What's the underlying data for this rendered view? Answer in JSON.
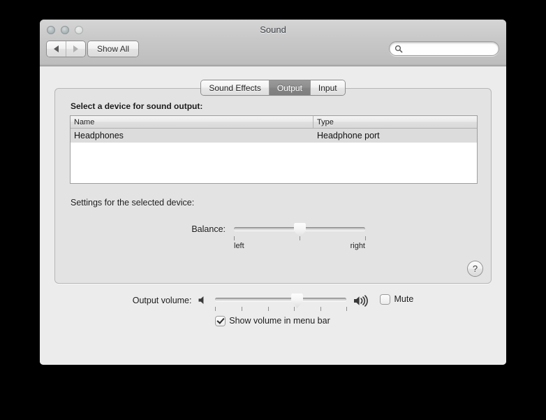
{
  "window": {
    "title": "Sound",
    "traffic_lights": [
      "close-button",
      "minimize-button",
      "zoom-button"
    ]
  },
  "toolbar": {
    "back_label": "◀",
    "forward_label": "▶",
    "show_all_label": "Show All",
    "search_value": "",
    "search_placeholder": ""
  },
  "tabs": [
    {
      "label": "Sound Effects",
      "active": false
    },
    {
      "label": "Output",
      "active": true
    },
    {
      "label": "Input",
      "active": false
    }
  ],
  "panel": {
    "device_list_label": "Select a device for sound output:",
    "table": {
      "columns": [
        "Name",
        "Type"
      ],
      "rows": [
        {
          "name": "Headphones",
          "type": "Headphone port",
          "selected": true
        }
      ]
    },
    "settings_label": "Settings for the selected device:",
    "balance": {
      "label": "Balance:",
      "value": 50,
      "min_label": "left",
      "max_label": "right",
      "tick_count": 3
    },
    "help_label": "?"
  },
  "bottom": {
    "output_volume_label": "Output volume:",
    "volume_value": 62,
    "volume_tick_count": 6,
    "speaker_low_icon": "speaker-quiet-icon",
    "speaker_high_icon": "speaker-loud-icon",
    "mute_label": "Mute",
    "mute_checked": false,
    "show_volume_label": "Show volume in menu bar",
    "show_volume_checked": true
  },
  "colors": {
    "window_bg": "#ececec",
    "panel_bg": "#e3e3e3",
    "titlebar_top": "#d5d5d5",
    "titlebar_bottom": "#bdbdbd",
    "active_tab_bg": "#848484",
    "selected_row_bg": "#dcdcdc",
    "desktop_bg": "#000000"
  }
}
